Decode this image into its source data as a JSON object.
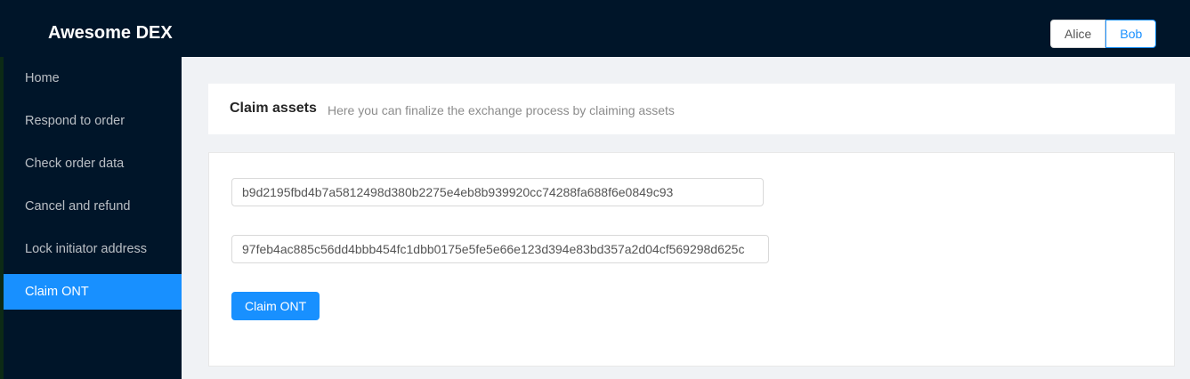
{
  "app": {
    "brand": "Awesome DEX"
  },
  "user_switch": {
    "alice": "Alice",
    "bob": "Bob",
    "selected": "Bob"
  },
  "sidebar": {
    "items": [
      {
        "label": "Home"
      },
      {
        "label": "Respond to order"
      },
      {
        "label": "Check order data"
      },
      {
        "label": "Cancel and refund"
      },
      {
        "label": "Lock initiator address"
      },
      {
        "label": "Claim ONT"
      }
    ],
    "selected": "Claim ONT"
  },
  "page": {
    "title": "Claim assets",
    "subtitle": "Here you can finalize the exchange process by claiming assets"
  },
  "form": {
    "field1_value": "b9d2195fbd4b7a5812498d380b2275e4eb8b939920cc74288fa688f6e0849c93",
    "field2_value": "97feb4ac885c56dd4bbb454fc1dbb0175e5fe5e66e123d394e83bd357a2d04cf569298d625c",
    "claim_label": "Claim ONT"
  },
  "colors": {
    "header_bg": "#001529",
    "accent": "#1890ff",
    "page_bg": "#f0f2f5"
  }
}
